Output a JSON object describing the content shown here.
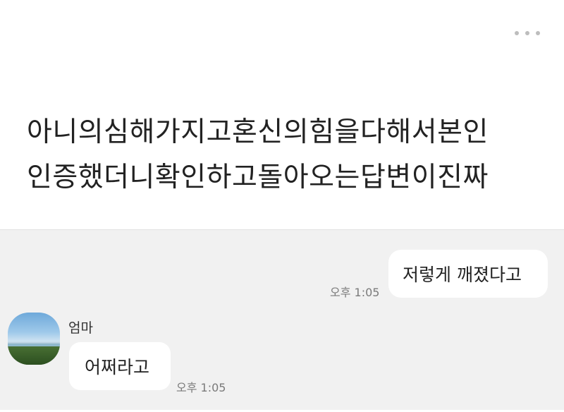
{
  "post": {
    "text_lines": [
      "아니의심해가지고혼신의힘을다해서본인",
      "인증했더니확인하고돌아오는답변이진짜"
    ],
    "more_icon": "more-horizontal-icon"
  },
  "chat": {
    "messages": [
      {
        "from": "me",
        "text": "저렇게 깨졌다고",
        "time": "오후 1:05"
      },
      {
        "from": "them",
        "sender": "엄마",
        "text": "어쩌라고",
        "time": "오후 1:05"
      }
    ]
  },
  "colors": {
    "chat_background": "#f1f1f1",
    "bubble": "#ffffff",
    "text": "#222222",
    "timestamp": "#7a7a7a"
  }
}
